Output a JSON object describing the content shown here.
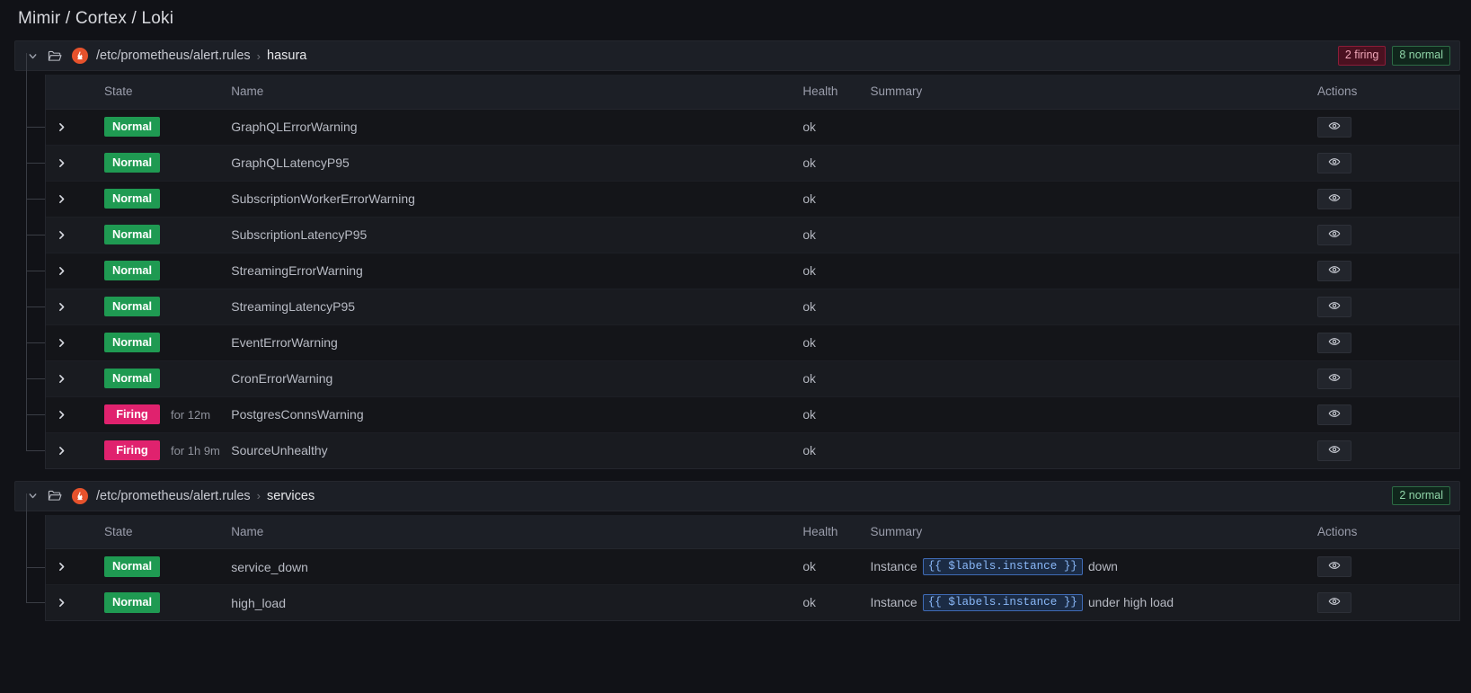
{
  "page": {
    "title": "Mimir / Cortex / Loki"
  },
  "icons": {
    "collapse": "chevron-down-icon",
    "folder": "folder-icon",
    "datasource": "prometheus-icon",
    "expand_row": "chevron-right-icon",
    "view": "eye-icon"
  },
  "colors": {
    "firing": "#e0226e",
    "normal": "#1f9a52",
    "prometheus": "#e6522c",
    "template_chip": "#8ab8f8",
    "background": "#111217"
  },
  "columns": [
    "State",
    "Name",
    "Health",
    "Summary",
    "Actions"
  ],
  "groups": [
    {
      "datasource_path": "/etc/prometheus/alert.rules",
      "separator": "›",
      "name": "hasura",
      "badges": [
        {
          "label": "2 firing",
          "kind": "firing"
        },
        {
          "label": "8 normal",
          "kind": "normal"
        }
      ],
      "rules": [
        {
          "state": "Normal",
          "state_kind": "normal",
          "for": "",
          "name": "GraphQLErrorWarning",
          "health": "ok",
          "summary_prefix": "",
          "summary_chip": "",
          "summary_suffix": ""
        },
        {
          "state": "Normal",
          "state_kind": "normal",
          "for": "",
          "name": "GraphQLLatencyP95",
          "health": "ok",
          "summary_prefix": "",
          "summary_chip": "",
          "summary_suffix": ""
        },
        {
          "state": "Normal",
          "state_kind": "normal",
          "for": "",
          "name": "SubscriptionWorkerErrorWarning",
          "health": "ok",
          "summary_prefix": "",
          "summary_chip": "",
          "summary_suffix": ""
        },
        {
          "state": "Normal",
          "state_kind": "normal",
          "for": "",
          "name": "SubscriptionLatencyP95",
          "health": "ok",
          "summary_prefix": "",
          "summary_chip": "",
          "summary_suffix": ""
        },
        {
          "state": "Normal",
          "state_kind": "normal",
          "for": "",
          "name": "StreamingErrorWarning",
          "health": "ok",
          "summary_prefix": "",
          "summary_chip": "",
          "summary_suffix": ""
        },
        {
          "state": "Normal",
          "state_kind": "normal",
          "for": "",
          "name": "StreamingLatencyP95",
          "health": "ok",
          "summary_prefix": "",
          "summary_chip": "",
          "summary_suffix": ""
        },
        {
          "state": "Normal",
          "state_kind": "normal",
          "for": "",
          "name": "EventErrorWarning",
          "health": "ok",
          "summary_prefix": "",
          "summary_chip": "",
          "summary_suffix": ""
        },
        {
          "state": "Normal",
          "state_kind": "normal",
          "for": "",
          "name": "CronErrorWarning",
          "health": "ok",
          "summary_prefix": "",
          "summary_chip": "",
          "summary_suffix": ""
        },
        {
          "state": "Firing",
          "state_kind": "firing",
          "for": "for 12m",
          "name": "PostgresConnsWarning",
          "health": "ok",
          "summary_prefix": "",
          "summary_chip": "",
          "summary_suffix": ""
        },
        {
          "state": "Firing",
          "state_kind": "firing",
          "for": "for 1h 9m",
          "name": "SourceUnhealthy",
          "health": "ok",
          "summary_prefix": "",
          "summary_chip": "",
          "summary_suffix": ""
        }
      ]
    },
    {
      "datasource_path": "/etc/prometheus/alert.rules",
      "separator": "›",
      "name": "services",
      "badges": [
        {
          "label": "2 normal",
          "kind": "normal"
        }
      ],
      "rules": [
        {
          "state": "Normal",
          "state_kind": "normal",
          "for": "",
          "name": "service_down",
          "health": "ok",
          "summary_prefix": "Instance",
          "summary_chip": "{{ $labels.instance }}",
          "summary_suffix": "down"
        },
        {
          "state": "Normal",
          "state_kind": "normal",
          "for": "",
          "name": "high_load",
          "health": "ok",
          "summary_prefix": "Instance",
          "summary_chip": "{{ $labels.instance }}",
          "summary_suffix": "under high load"
        }
      ]
    }
  ]
}
